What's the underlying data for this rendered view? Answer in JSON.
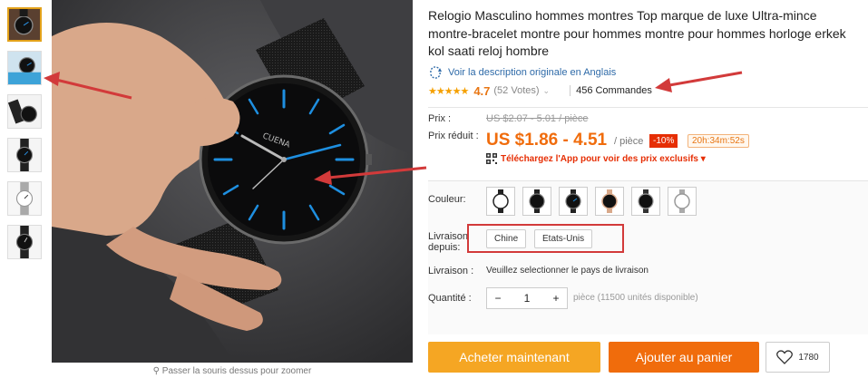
{
  "product": {
    "title": "Relogio Masculino hommes montres Top marque de luxe Ultra-mince montre-bracelet montre pour hommes montre pour hommes horloge erkek kol saati reloj hombre",
    "original_desc_link": "Voir la description originale en Anglais",
    "stars": "★★★★★",
    "rating": "4.7",
    "votes": "(52 Votes)",
    "votes_caret": "⌄",
    "orders": "456 Commandes",
    "watch_brand": "CUENA"
  },
  "price": {
    "label": "Prix :",
    "old": "US $2.07 - 5.01 / pièce",
    "reduced_label": "Prix réduit :",
    "current": "US $1.86 - 4.51",
    "unit": "/ pièce",
    "discount": "-10%",
    "timer": "20h:34m:52s",
    "app_promo": "Téléchargez l'App pour voir des prix exclusifs ▾"
  },
  "options": {
    "color_label": "Couleur:",
    "shipping_from_label": "Livraison depuis:",
    "shipping_from_options": [
      "Chine",
      "Etats-Unis"
    ],
    "delivery_label": "Livraison :",
    "delivery_note": "Veuillez selectionner le pays de livraison",
    "quantity_label": "Quantité :",
    "minus": "−",
    "quantity": "1",
    "plus": "+",
    "stock": "pièce (11500 unités disponible)"
  },
  "actions": {
    "buy_now": "Acheter maintenant",
    "add_to_cart": "Ajouter au panier",
    "wishlist_count": "1780"
  },
  "gallery": {
    "zoom_hint": "Passer la souris dessus pour zoomer"
  },
  "colors": {
    "accent": "#f06c0c",
    "buy_button": "#f5a623",
    "annotation": "#d23a3a",
    "watch_hands": "#1e8fe0"
  }
}
